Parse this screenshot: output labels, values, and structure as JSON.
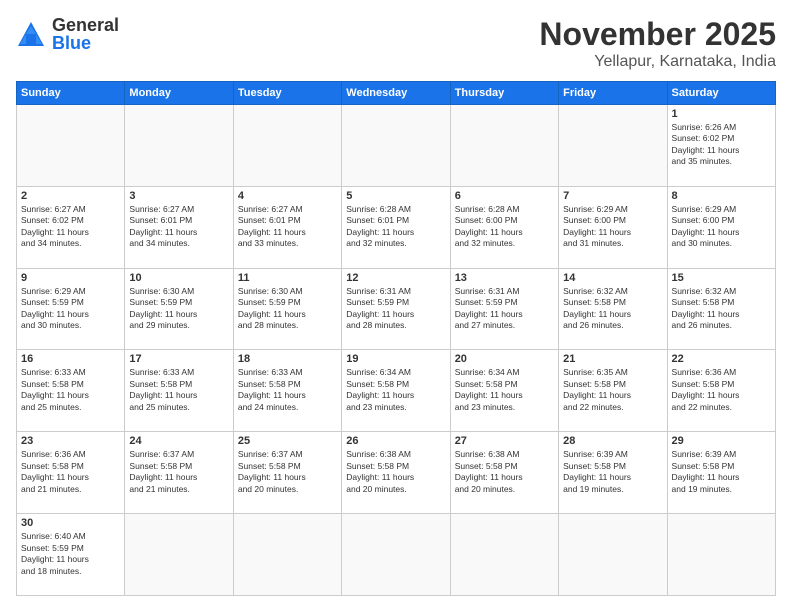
{
  "header": {
    "logo": {
      "general": "General",
      "blue": "Blue"
    },
    "title": "November 2025",
    "location": "Yellapur, Karnataka, India"
  },
  "weekdays": [
    "Sunday",
    "Monday",
    "Tuesday",
    "Wednesday",
    "Thursday",
    "Friday",
    "Saturday"
  ],
  "weeks": [
    [
      {
        "day": "",
        "info": ""
      },
      {
        "day": "",
        "info": ""
      },
      {
        "day": "",
        "info": ""
      },
      {
        "day": "",
        "info": ""
      },
      {
        "day": "",
        "info": ""
      },
      {
        "day": "",
        "info": ""
      },
      {
        "day": "1",
        "info": "Sunrise: 6:26 AM\nSunset: 6:02 PM\nDaylight: 11 hours\nand 35 minutes."
      }
    ],
    [
      {
        "day": "2",
        "info": "Sunrise: 6:27 AM\nSunset: 6:02 PM\nDaylight: 11 hours\nand 34 minutes."
      },
      {
        "day": "3",
        "info": "Sunrise: 6:27 AM\nSunset: 6:01 PM\nDaylight: 11 hours\nand 34 minutes."
      },
      {
        "day": "4",
        "info": "Sunrise: 6:27 AM\nSunset: 6:01 PM\nDaylight: 11 hours\nand 33 minutes."
      },
      {
        "day": "5",
        "info": "Sunrise: 6:28 AM\nSunset: 6:01 PM\nDaylight: 11 hours\nand 32 minutes."
      },
      {
        "day": "6",
        "info": "Sunrise: 6:28 AM\nSunset: 6:00 PM\nDaylight: 11 hours\nand 32 minutes."
      },
      {
        "day": "7",
        "info": "Sunrise: 6:29 AM\nSunset: 6:00 PM\nDaylight: 11 hours\nand 31 minutes."
      },
      {
        "day": "8",
        "info": "Sunrise: 6:29 AM\nSunset: 6:00 PM\nDaylight: 11 hours\nand 30 minutes."
      }
    ],
    [
      {
        "day": "9",
        "info": "Sunrise: 6:29 AM\nSunset: 5:59 PM\nDaylight: 11 hours\nand 30 minutes."
      },
      {
        "day": "10",
        "info": "Sunrise: 6:30 AM\nSunset: 5:59 PM\nDaylight: 11 hours\nand 29 minutes."
      },
      {
        "day": "11",
        "info": "Sunrise: 6:30 AM\nSunset: 5:59 PM\nDaylight: 11 hours\nand 28 minutes."
      },
      {
        "day": "12",
        "info": "Sunrise: 6:31 AM\nSunset: 5:59 PM\nDaylight: 11 hours\nand 28 minutes."
      },
      {
        "day": "13",
        "info": "Sunrise: 6:31 AM\nSunset: 5:59 PM\nDaylight: 11 hours\nand 27 minutes."
      },
      {
        "day": "14",
        "info": "Sunrise: 6:32 AM\nSunset: 5:58 PM\nDaylight: 11 hours\nand 26 minutes."
      },
      {
        "day": "15",
        "info": "Sunrise: 6:32 AM\nSunset: 5:58 PM\nDaylight: 11 hours\nand 26 minutes."
      }
    ],
    [
      {
        "day": "16",
        "info": "Sunrise: 6:33 AM\nSunset: 5:58 PM\nDaylight: 11 hours\nand 25 minutes."
      },
      {
        "day": "17",
        "info": "Sunrise: 6:33 AM\nSunset: 5:58 PM\nDaylight: 11 hours\nand 25 minutes."
      },
      {
        "day": "18",
        "info": "Sunrise: 6:33 AM\nSunset: 5:58 PM\nDaylight: 11 hours\nand 24 minutes."
      },
      {
        "day": "19",
        "info": "Sunrise: 6:34 AM\nSunset: 5:58 PM\nDaylight: 11 hours\nand 23 minutes."
      },
      {
        "day": "20",
        "info": "Sunrise: 6:34 AM\nSunset: 5:58 PM\nDaylight: 11 hours\nand 23 minutes."
      },
      {
        "day": "21",
        "info": "Sunrise: 6:35 AM\nSunset: 5:58 PM\nDaylight: 11 hours\nand 22 minutes."
      },
      {
        "day": "22",
        "info": "Sunrise: 6:36 AM\nSunset: 5:58 PM\nDaylight: 11 hours\nand 22 minutes."
      }
    ],
    [
      {
        "day": "23",
        "info": "Sunrise: 6:36 AM\nSunset: 5:58 PM\nDaylight: 11 hours\nand 21 minutes."
      },
      {
        "day": "24",
        "info": "Sunrise: 6:37 AM\nSunset: 5:58 PM\nDaylight: 11 hours\nand 21 minutes."
      },
      {
        "day": "25",
        "info": "Sunrise: 6:37 AM\nSunset: 5:58 PM\nDaylight: 11 hours\nand 20 minutes."
      },
      {
        "day": "26",
        "info": "Sunrise: 6:38 AM\nSunset: 5:58 PM\nDaylight: 11 hours\nand 20 minutes."
      },
      {
        "day": "27",
        "info": "Sunrise: 6:38 AM\nSunset: 5:58 PM\nDaylight: 11 hours\nand 20 minutes."
      },
      {
        "day": "28",
        "info": "Sunrise: 6:39 AM\nSunset: 5:58 PM\nDaylight: 11 hours\nand 19 minutes."
      },
      {
        "day": "29",
        "info": "Sunrise: 6:39 AM\nSunset: 5:58 PM\nDaylight: 11 hours\nand 19 minutes."
      }
    ],
    [
      {
        "day": "30",
        "info": "Sunrise: 6:40 AM\nSunset: 5:59 PM\nDaylight: 11 hours\nand 18 minutes."
      },
      {
        "day": "",
        "info": ""
      },
      {
        "day": "",
        "info": ""
      },
      {
        "day": "",
        "info": ""
      },
      {
        "day": "",
        "info": ""
      },
      {
        "day": "",
        "info": ""
      },
      {
        "day": "",
        "info": ""
      }
    ]
  ]
}
